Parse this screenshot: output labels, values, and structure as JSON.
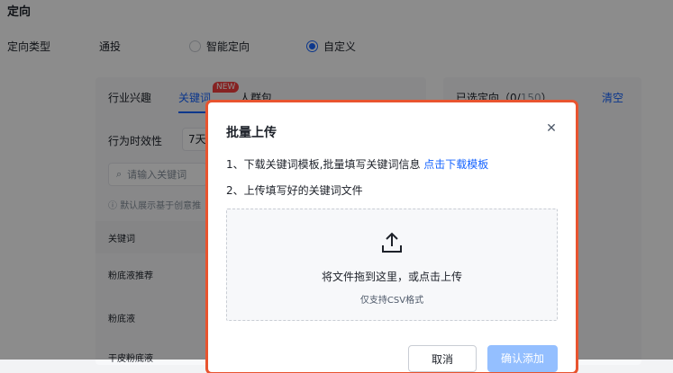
{
  "page": {
    "section_title": "定向",
    "targeting_type_label": "定向类型",
    "radio_options": [
      {
        "label": "通投",
        "checked": false
      },
      {
        "label": "智能定向",
        "checked": false
      },
      {
        "label": "自定义",
        "checked": true
      }
    ],
    "tabs": [
      {
        "label": "行业兴趣",
        "active": false
      },
      {
        "label": "关键词",
        "active": true
      },
      {
        "label": "人群包",
        "active": false
      }
    ],
    "new_badge": "NEW",
    "behavior_timeliness_label": "行为时效性",
    "behavior_timeliness_value": "7天",
    "search_placeholder": "请输入关键词",
    "info_text": "默认展示基于创意推",
    "table_header": "关键词",
    "table_rows": [
      "粉底液推荐",
      "粉底液",
      "干皮粉底液"
    ],
    "selected_label": "已选定向（0/",
    "selected_total": "150",
    "selected_close": "）",
    "clear_label": "清空"
  },
  "dialog": {
    "title": "批量上传",
    "step1_text": "1、下载关键词模板,批量填写关键词信息",
    "step1_link": "点击下载模板",
    "step2_text": "2、上传填写好的关键词文件",
    "drop_main": "将文件拖到这里，或点击上传",
    "drop_sub": "仅支持CSV格式",
    "cancel_label": "取消",
    "confirm_label": "确认添加"
  },
  "colors": {
    "accent": "#1664ff",
    "dialog_border": "#e8542f",
    "confirm_disabled": "#94bfff"
  }
}
